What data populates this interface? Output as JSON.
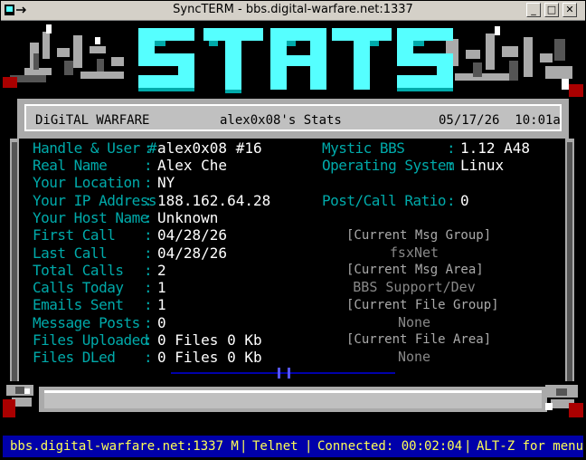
{
  "window": {
    "title": "SyncTERM - bbs.digital-warfare.net:1337",
    "minimize": "_",
    "maximize": "□",
    "close": "✕"
  },
  "banner": {
    "text": "STATS"
  },
  "header": {
    "left": "DiGiTAL WARFARE",
    "center": "alex0x08's Stats",
    "right": "05/17/26  10:01a"
  },
  "stats": [
    {
      "label": "Handle & User #",
      "value": "alex0x08 #16"
    },
    {
      "label": "Real Name",
      "value": "Alex Che"
    },
    {
      "label": "Your Location",
      "value": "NY"
    },
    {
      "label": "Your IP Address",
      "value": "188.162.64.28"
    },
    {
      "label": "Your Host Name",
      "value": "Unknown"
    },
    {
      "label": "First Call",
      "value": "04/28/26"
    },
    {
      "label": "Last Call",
      "value": "04/28/26"
    },
    {
      "label": "Total Calls",
      "value": "2"
    },
    {
      "label": "Calls Today",
      "value": "1"
    },
    {
      "label": "Emails Sent",
      "value": "1"
    },
    {
      "label": "Message Posts",
      "value": "0"
    },
    {
      "label": "Files Uploaded",
      "value": "0 Files 0 Kb"
    },
    {
      "label": "Files DLed",
      "value": "0 Files 0 Kb"
    }
  ],
  "system": {
    "bbs_label": "Mystic BBS",
    "bbs_value": "1.12 A48",
    "os_label": "Operating System",
    "os_value": "Linux",
    "ratio_label": "Post/Call Ratio",
    "ratio_value": "0"
  },
  "groups": {
    "msg_group_header": "[Current Msg Group]",
    "msg_group_value": "fsxNet",
    "msg_area_header": "[Current Msg Area]",
    "msg_area_value": "BBS Support/Dev",
    "file_group_header": "[Current File Group]",
    "file_group_value": "None",
    "file_area_header": "[Current File Area]",
    "file_area_value": "None"
  },
  "status": {
    "host": "bbs.digital-warfare.net:1337 M",
    "protocol": "Telnet",
    "connected": "Connected: 00:02:04",
    "help": "ALT-Z for menu"
  },
  "colors": {
    "cyan": "#00aaaa",
    "blue": "#0000aa",
    "yellow": "#ffff55",
    "banner": "#55ffff"
  }
}
